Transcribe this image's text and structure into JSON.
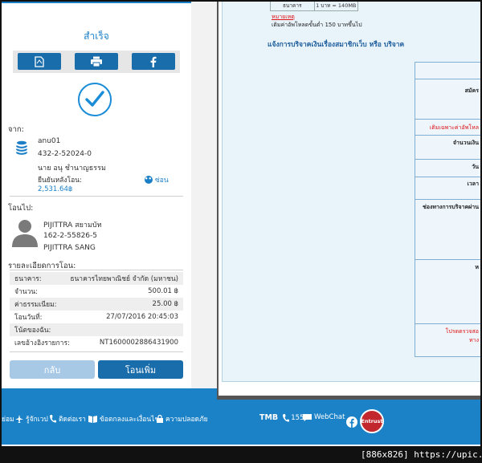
{
  "receipt": {
    "title": "สำเร็จ",
    "share": [
      "pdf-icon",
      "printer-icon",
      "facebook-icon"
    ],
    "from_label": "จาก:",
    "from": {
      "nickname": "anu01",
      "account_no": "432-2-52024-0",
      "owner": "นาย อนุ ชำนาญธรรม",
      "balance_label": "ยืนยันหลังโอน:",
      "balance": "2,531.64฿",
      "hide_label": "ซ่อน"
    },
    "to_label": "โอนไป:",
    "to": {
      "nickname": "PIJITTRA สยามบัท",
      "account_no": "162-2-55826-5",
      "name": "PIJITTRA SANG"
    },
    "details_label": "รายละเอียดการโอน:",
    "details": [
      {
        "label": "ธนาคาร:",
        "value": "ธนาคารไทยพาณิชย์ จำกัด (มหาชน)"
      },
      {
        "label": "จำนวน:",
        "value": "500.01 ฿"
      },
      {
        "label": "ค่าธรรมเนียม:",
        "value": "25.00 ฿"
      },
      {
        "label": "โอนวันที่:",
        "value": "27/07/2016 20:45:03"
      },
      {
        "label": "โน้ตของฉัน:",
        "value": ""
      },
      {
        "label": "เลขอ้างอิงรายการ:",
        "value": "NT1600002886431900"
      }
    ],
    "back_label": "กลับ",
    "more_label": "โอนเพิ่ม"
  },
  "footer": {
    "items": [
      "ย่อม",
      "รู้จักเวป",
      "ติดต่อเรา",
      "ข้อตกลงและเงื่อนไข",
      "ความปลอดภัย"
    ],
    "brand": "TMB",
    "phone": "1558",
    "webchat": "WebChat",
    "entrust": "Entrust"
  },
  "overlay": {
    "table_cells": [
      "ธนาคาร",
      "1 บาท = 140MB"
    ],
    "red_link": "หมายเหตุ",
    "note": "เติมค่าอัพโหลดขั้นต่ำ 150 บาทขึ้นไป",
    "form_title": "แจ้งการบริจาคเงินเรื่องสมาชิกเว็บ หรือ บริจาค",
    "form_labels": [
      {
        "text": "สมัคร",
        "red": false
      },
      {
        "text": "เติมเฉพาะค่าอัพโหล",
        "red": true
      },
      {
        "text": "จำนวนเงิน",
        "red": false
      },
      {
        "text": "วัน",
        "red": false
      },
      {
        "text": "เวลา",
        "red": false
      },
      {
        "text": "ช่องทางการบริจาคผ่าน",
        "red": false
      },
      {
        "text": "ห",
        "red": false
      },
      {
        "text": "โปรดตรวจสอ",
        "red": true
      },
      {
        "text": "ทาง",
        "red": true
      }
    ]
  },
  "watermark": "[886x826] https://upic.me/",
  "colors": {
    "accent": "#1a7fc7",
    "button": "#1a6dab",
    "footer": "#1b82c7",
    "red": "#d11111"
  }
}
